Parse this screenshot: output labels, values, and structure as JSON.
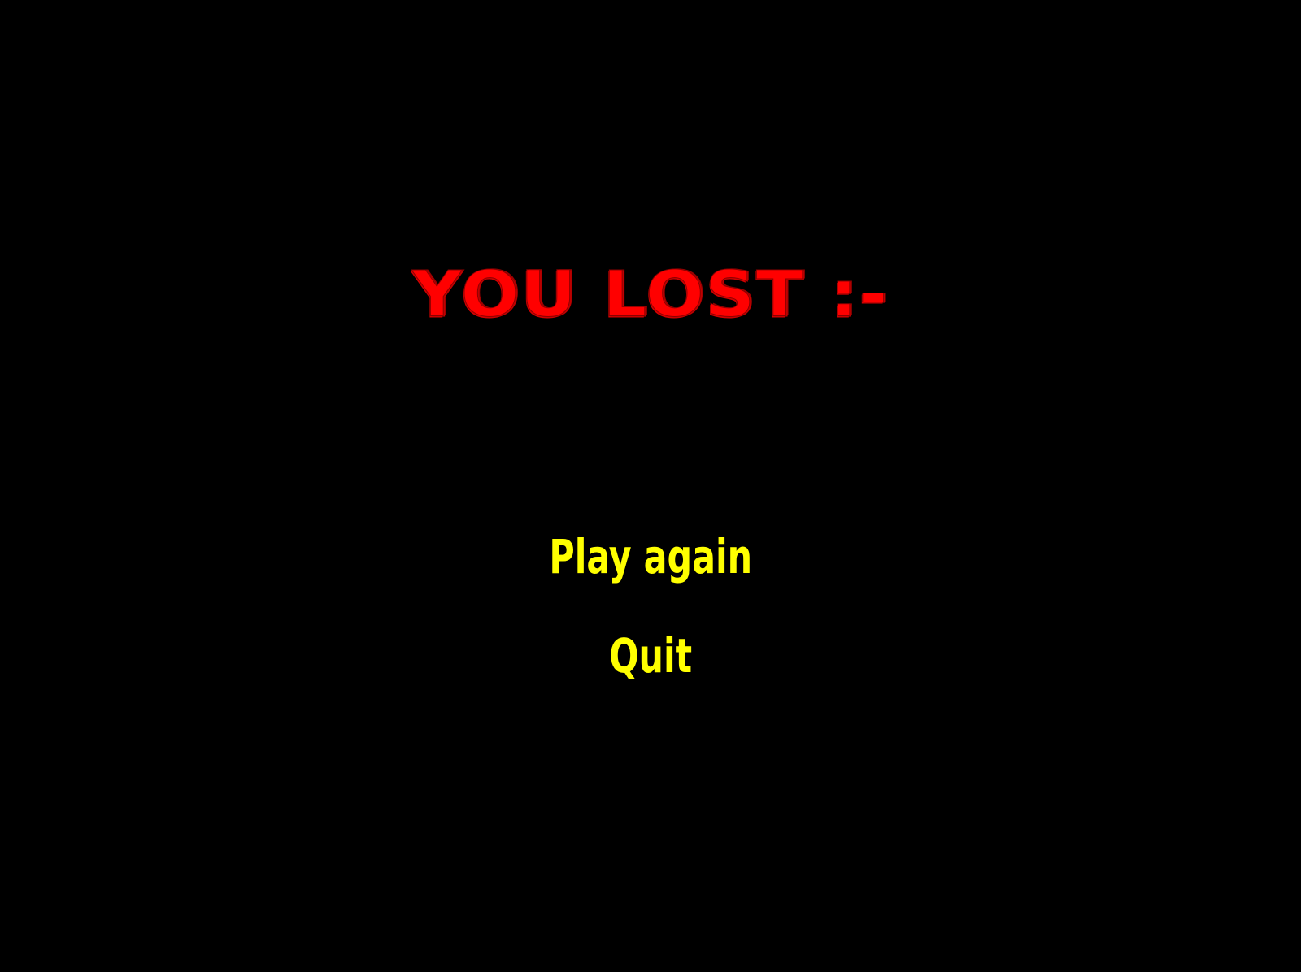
{
  "screen": {
    "title": "YOU LOST :-",
    "title_color": "#ff0000",
    "background_color": "#000000"
  },
  "menu": {
    "items": [
      {
        "label": "Play again"
      },
      {
        "label": "Quit"
      }
    ],
    "text_color": "#ffff00"
  }
}
